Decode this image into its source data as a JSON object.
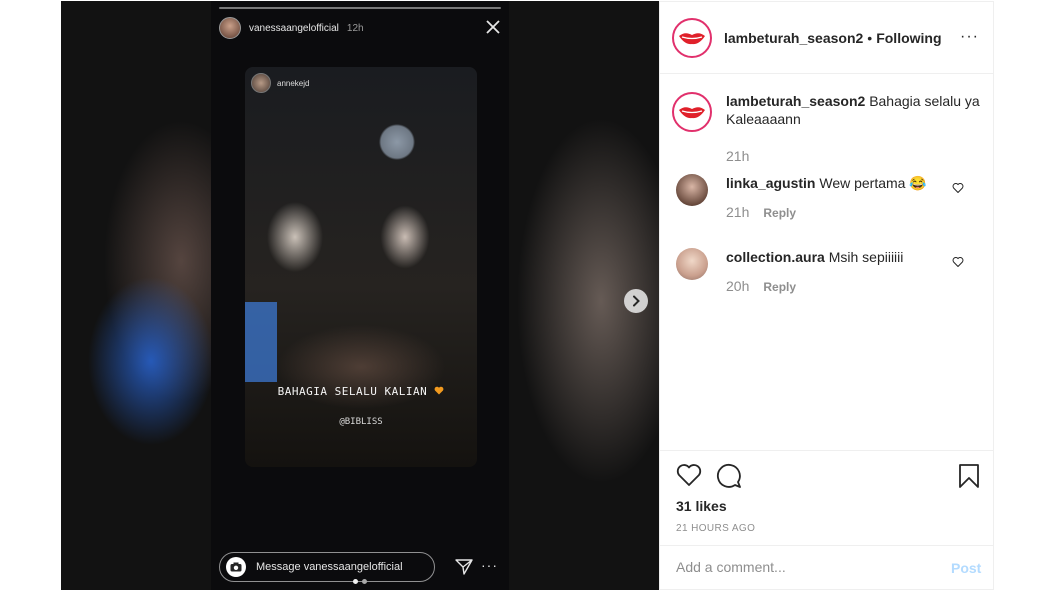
{
  "story": {
    "username": "vanessaangelofficial",
    "time": "12h",
    "inner_username": "annekejd",
    "caption": "BAHAGIA SELALU KALIAN",
    "caption_emoji": "orange-heart",
    "sub_caption": "@BIBLISS",
    "reply_placeholder": "Message vanessaangelofficial"
  },
  "post": {
    "username": "lambeturah_season2",
    "separator": "•",
    "follow_status": "Following",
    "caption_username": "lambeturah_season2",
    "caption_text": "Bahagia selalu ya Kaleaaaann",
    "caption_time": "21h",
    "likes": "31 likes",
    "time_ago": "21 HOURS AGO",
    "add_comment_placeholder": "Add a comment...",
    "post_label": "Post"
  },
  "comments": [
    {
      "username": "linka_agustin",
      "text": "Wew pertama 😂",
      "time": "21h",
      "reply": "Reply"
    },
    {
      "username": "collection.aura",
      "text": "Msih sepiiiiii",
      "time": "20h",
      "reply": "Reply"
    }
  ],
  "colors": {
    "brand_ring": "#e1306c",
    "lips": "#e0202a",
    "post_disabled": "#b3dbff"
  }
}
